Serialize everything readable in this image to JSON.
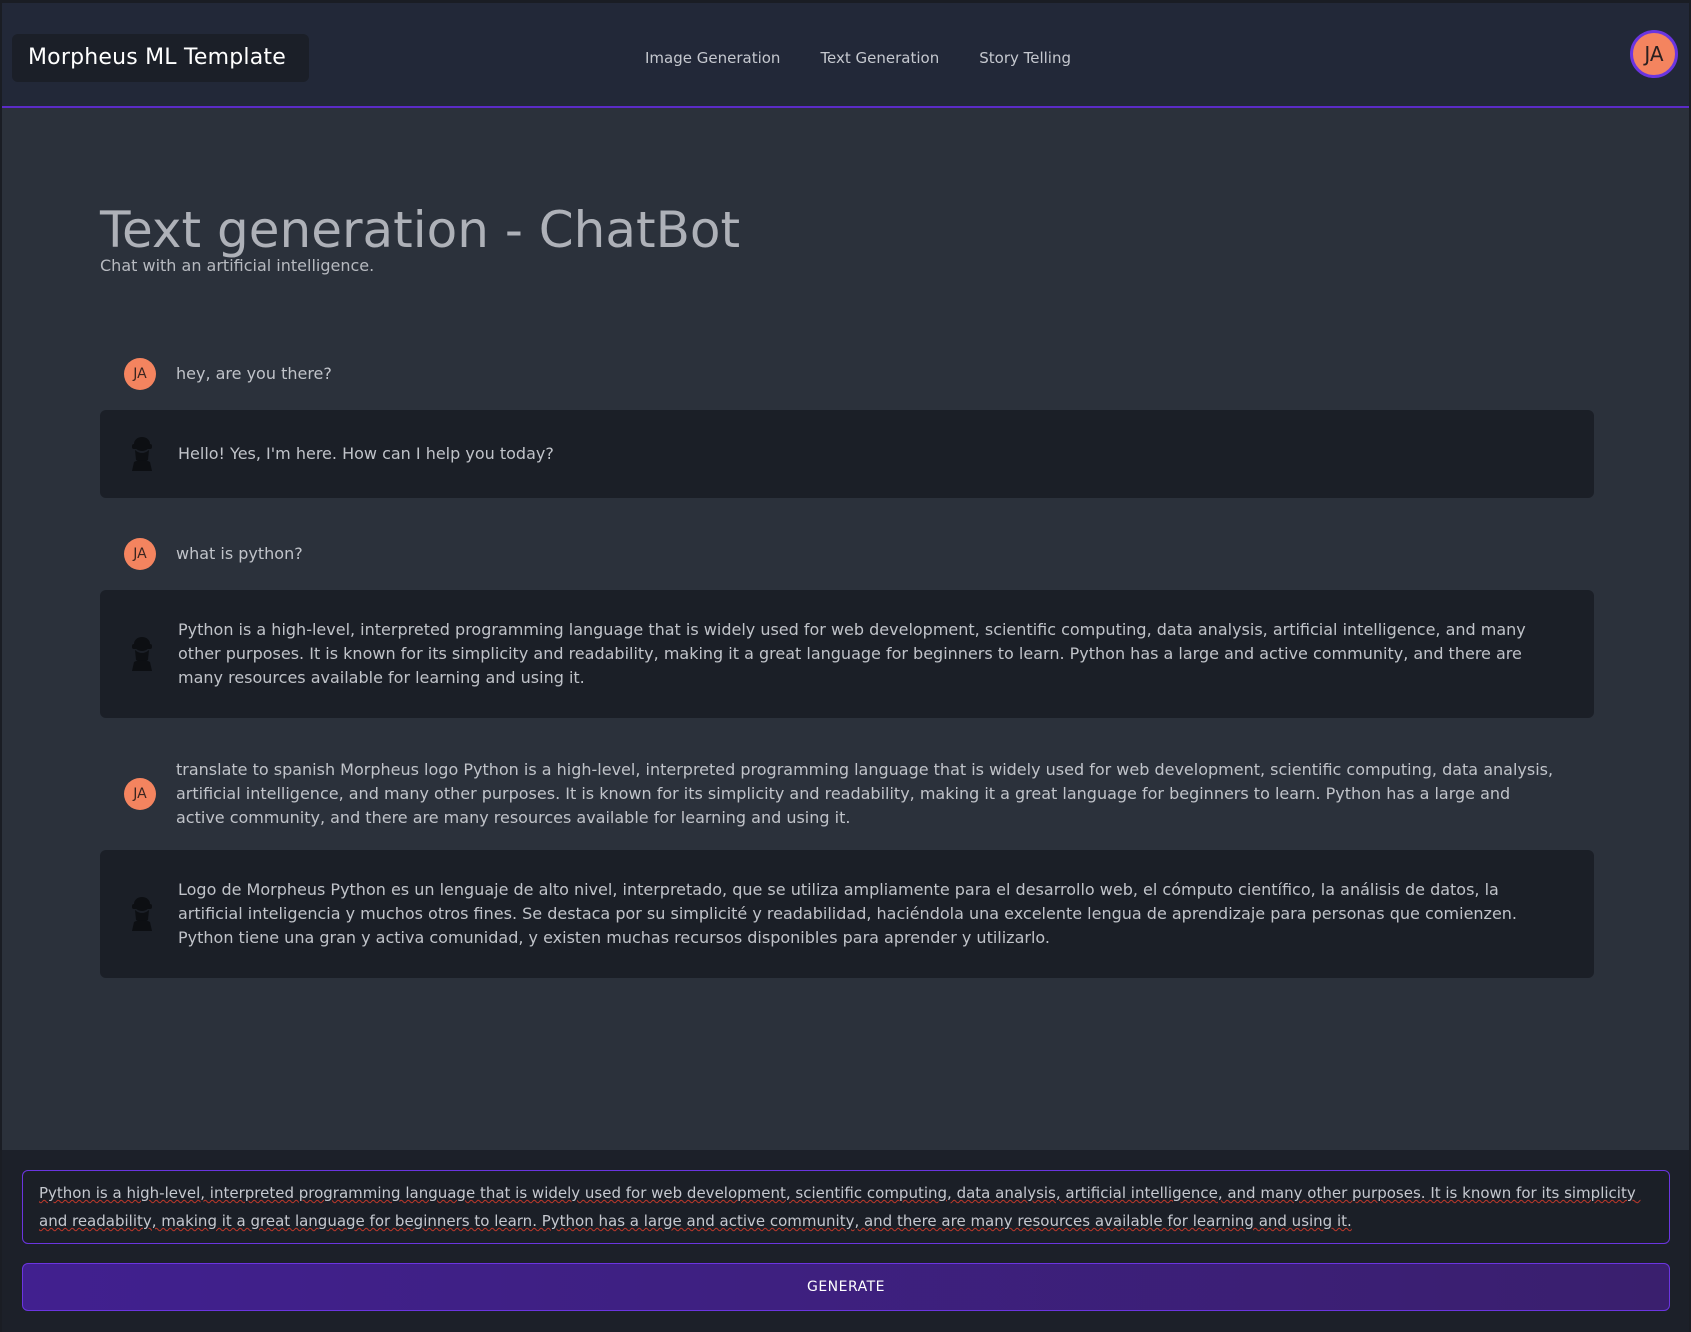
{
  "header": {
    "brand": "Morpheus ML Template",
    "nav": [
      {
        "label": "Image Generation"
      },
      {
        "label": "Text Generation"
      },
      {
        "label": "Story Telling"
      }
    ],
    "user_initials": "JA"
  },
  "page": {
    "title": "Text generation - ChatBot",
    "subtitle": "Chat with an artificial intelligence."
  },
  "chat": [
    {
      "role": "user",
      "initials": "JA",
      "text": "hey, are you there?"
    },
    {
      "role": "bot",
      "icon": "morpheus-logo-icon",
      "text": "Hello! Yes, I'm here. How can I help you today?"
    },
    {
      "role": "user",
      "initials": "JA",
      "text": "what is python?"
    },
    {
      "role": "bot",
      "icon": "morpheus-logo-icon",
      "text": "Python is a high-level, interpreted programming language that is widely used for web development, scientific computing, data analysis, artificial intelligence, and many other purposes. It is known for its simplicity and readability, making it a great language for beginners to learn. Python has a large and active community, and there are many resources available for learning and using it."
    },
    {
      "role": "user",
      "initials": "JA",
      "text": "translate to spanish Morpheus logo Python is a high-level, interpreted programming language that is widely used for web development, scientific computing, data analysis, artificial intelligence, and many other purposes. It is known for its simplicity and readability, making it a great language for beginners to learn. Python has a large and active community, and there are many resources available for learning and using it."
    },
    {
      "role": "bot",
      "icon": "morpheus-logo-icon",
      "text": "Logo de Morpheus Python es un lenguaje de alto nivel, interpretado, que se utiliza ampliamente para el desarrollo web, el cómputo científico, la análisis de datos, la artificial inteligencia y muchos otros fines. Se destaca por su simplicité y readabilidad, haciéndola una excelente lengua de aprendizaje para personas que comienzen. Python tiene una gran y activa comunidad, y existen muchas recursos disponibles para aprender y utilizarlo."
    }
  ],
  "composer": {
    "value": "Python is a high-level, interpreted programming language that is widely used for web development, scientific computing, data analysis, artificial intelligence, and many other purposes. It is known for its simplicity and readability, making it a great language for beginners to learn. Python has a large and active community, and there are many resources available for learning and using it.",
    "button_label": "GENERATE"
  },
  "colors": {
    "accent": "#6b35e0",
    "avatar": "#f4845f",
    "background": "#2b313b",
    "bot_bubble": "#1b1f27"
  }
}
